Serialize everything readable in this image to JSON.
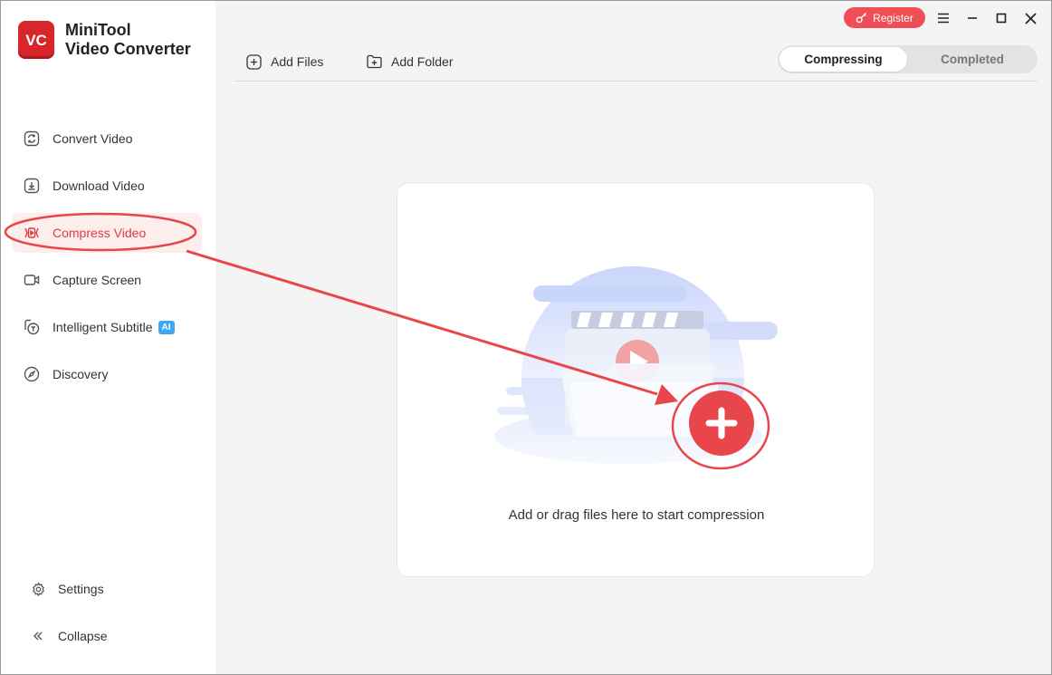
{
  "app": {
    "name_line1": "MiniTool",
    "name_line2": "Video Converter",
    "logo_text": "VC"
  },
  "titlebar": {
    "register_label": "Register"
  },
  "sidebar": {
    "items": [
      {
        "label": "Convert Video",
        "icon": "convert-icon"
      },
      {
        "label": "Download Video",
        "icon": "download-icon"
      },
      {
        "label": "Compress Video",
        "icon": "compress-icon",
        "active": true
      },
      {
        "label": "Capture Screen",
        "icon": "camera-icon"
      },
      {
        "label": "Intelligent Subtitle",
        "icon": "subtitle-icon",
        "badge": "AI"
      },
      {
        "label": "Discovery",
        "icon": "compass-icon"
      }
    ],
    "bottom": [
      {
        "label": "Settings",
        "icon": "gear-icon"
      },
      {
        "label": "Collapse",
        "icon": "double-chevron-left-icon"
      }
    ]
  },
  "toolbar": {
    "add_files": "Add Files",
    "add_folder": "Add Folder",
    "tabs": [
      "Compressing",
      "Completed"
    ],
    "active_tab": "Compressing"
  },
  "dropzone": {
    "text": "Add or drag files here to start compression"
  },
  "colors": {
    "accent": "#e03a3e",
    "register": "#ef4f54",
    "badge": "#3fa6f5",
    "annotation": "#e8464a"
  }
}
